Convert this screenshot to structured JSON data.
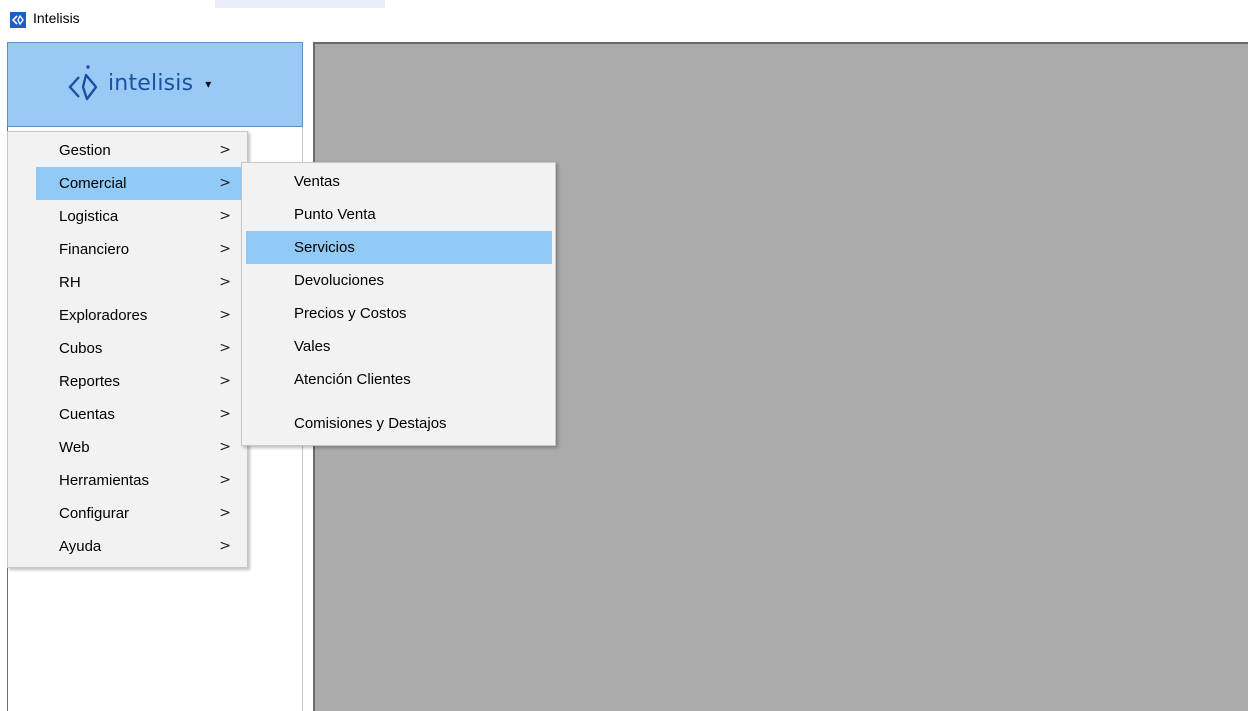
{
  "window": {
    "title": "Intelisis"
  },
  "logo": {
    "text": "intelisis",
    "dropdown_glyph": "▾",
    "icon": "intelisis-logo-icon"
  },
  "main_menu": {
    "items": [
      {
        "label": "Gestion",
        "arrow": ">"
      },
      {
        "label": "Comercial",
        "arrow": ">",
        "highlighted": true
      },
      {
        "label": "Logistica",
        "arrow": ">"
      },
      {
        "label": "Financiero",
        "arrow": ">"
      },
      {
        "label": "RH",
        "arrow": ">"
      },
      {
        "label": "Exploradores",
        "arrow": ">"
      },
      {
        "label": "Cubos",
        "arrow": ">"
      },
      {
        "label": "Reportes",
        "arrow": ">"
      },
      {
        "label": "Cuentas",
        "arrow": ">"
      },
      {
        "label": "Web",
        "arrow": ">"
      },
      {
        "label": "Herramientas",
        "arrow": ">"
      },
      {
        "label": "Configurar",
        "arrow": ">"
      },
      {
        "label": "Ayuda",
        "arrow": ">"
      }
    ]
  },
  "sub_menu": {
    "items": [
      {
        "label": "Ventas"
      },
      {
        "label": "Punto Venta"
      },
      {
        "label": "Servicios",
        "highlighted": true
      },
      {
        "label": "Devoluciones"
      },
      {
        "label": "Precios y Costos"
      },
      {
        "label": "Vales"
      },
      {
        "label": "Atención Clientes"
      },
      {
        "label": "Comisiones y Destajos"
      }
    ]
  },
  "colors": {
    "highlight": "#91c9f7",
    "logo_bg": "#99c9f5",
    "workspace": "#ababab",
    "brand": "#1f4ea3"
  }
}
